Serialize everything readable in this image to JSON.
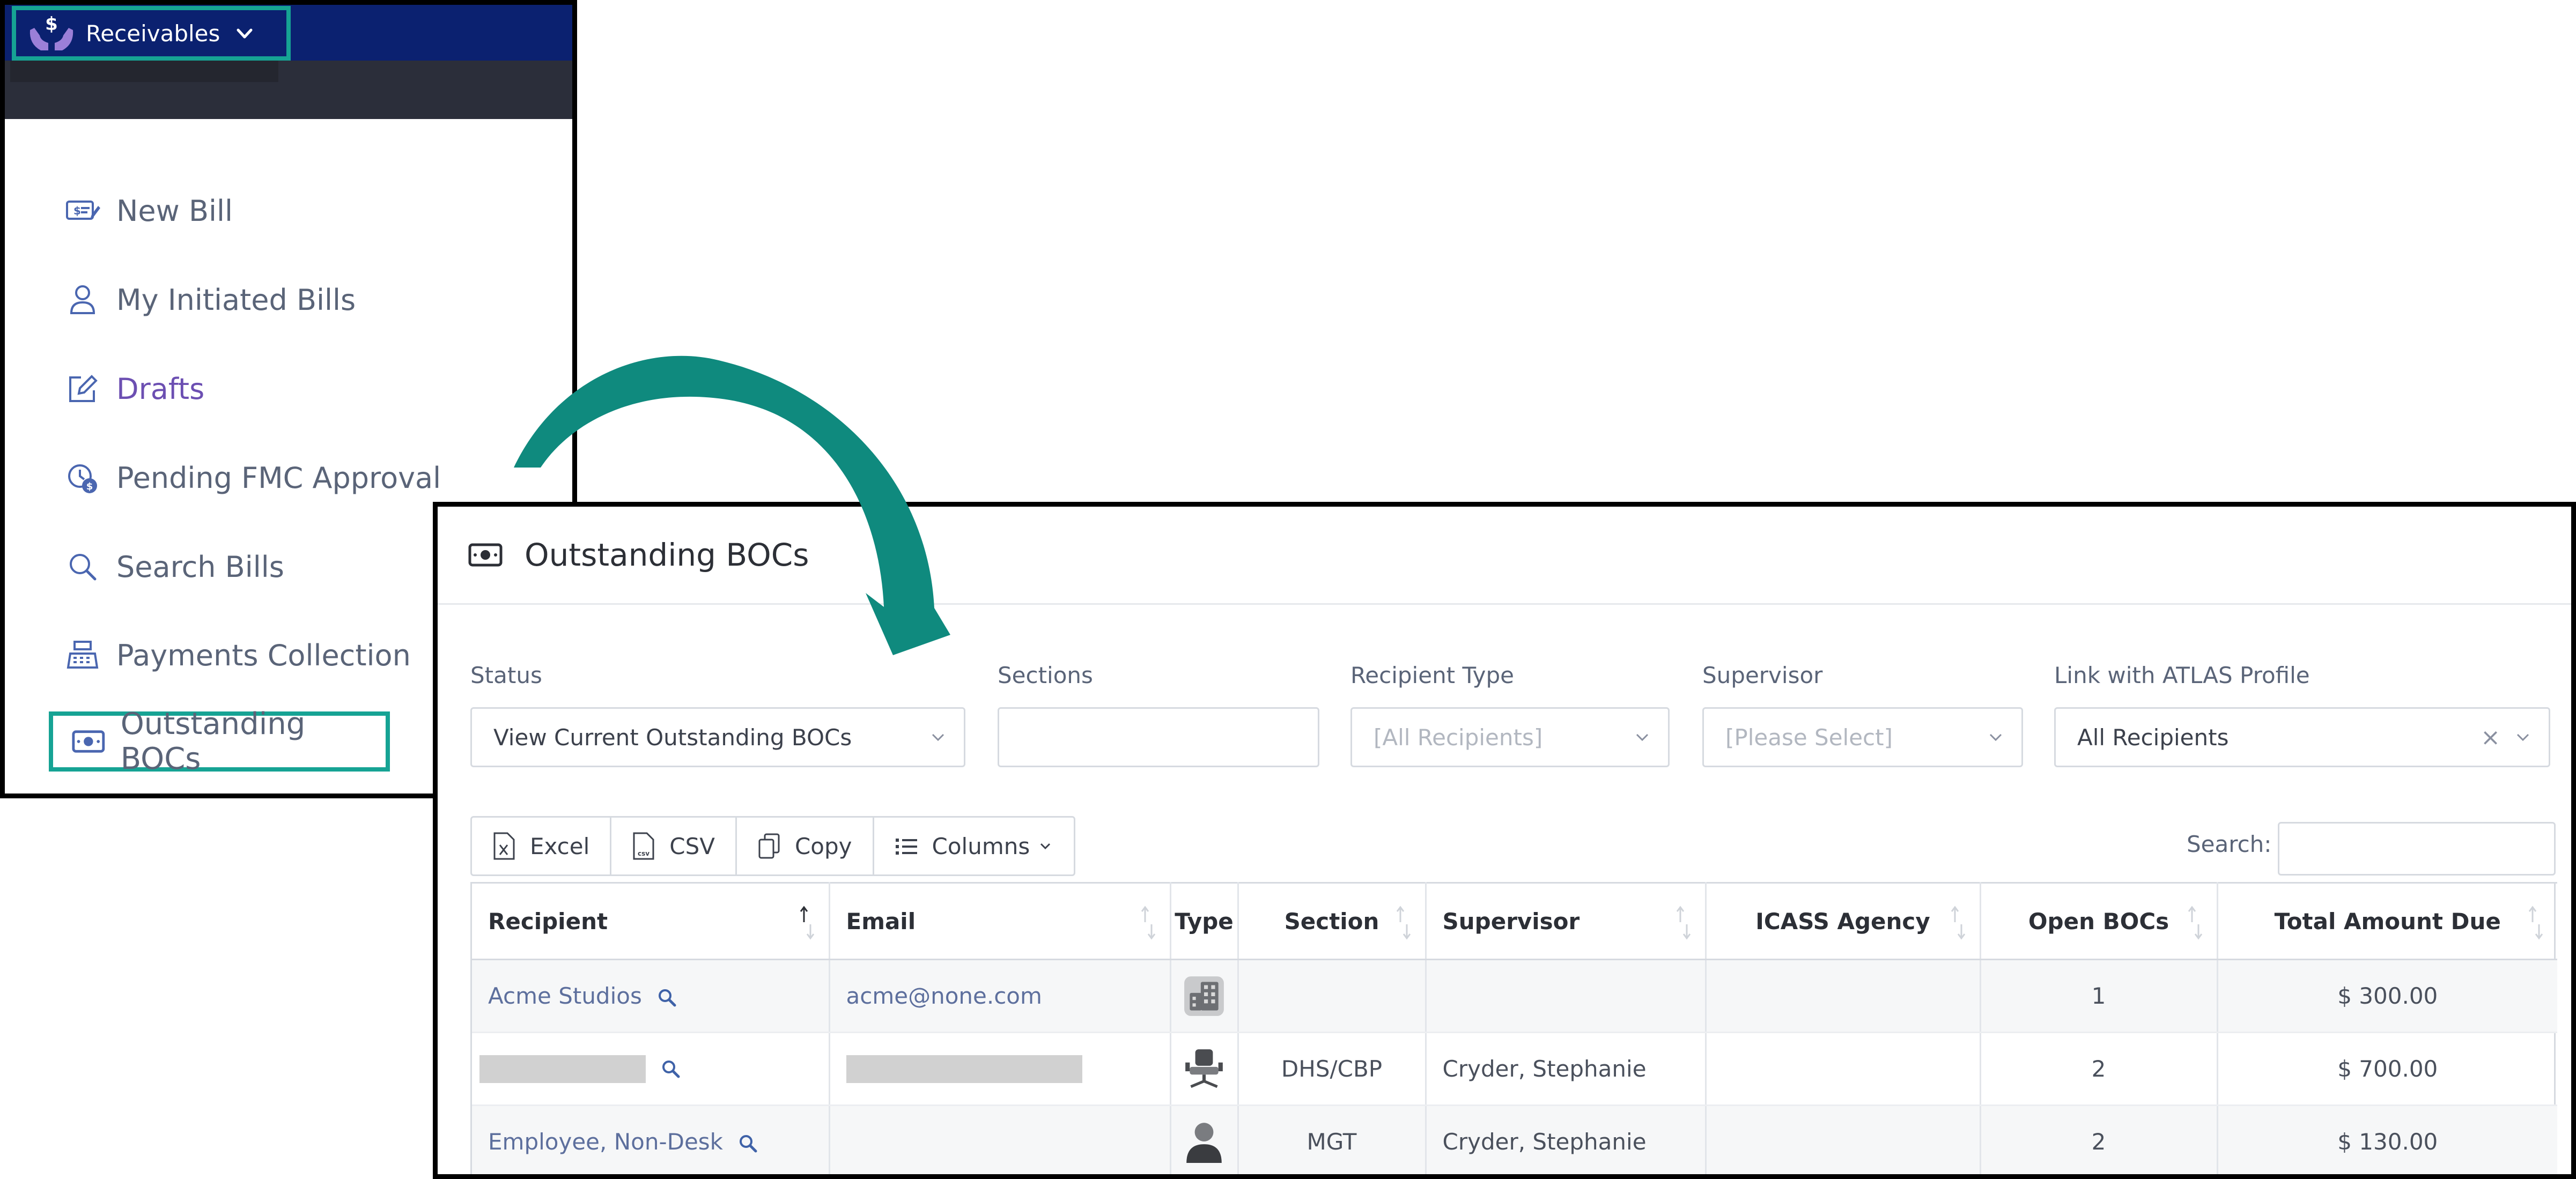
{
  "menu": {
    "dropdown_label": "Receivables",
    "items": [
      {
        "label": "New Bill",
        "icon": "bill-edit-icon"
      },
      {
        "label": "My Initiated Bills",
        "icon": "user-icon"
      },
      {
        "label": "Drafts",
        "icon": "edit-icon"
      },
      {
        "label": "Pending FMC Approval",
        "icon": "pending-money-icon"
      },
      {
        "label": "Search Bills",
        "icon": "search-icon"
      },
      {
        "label": "Payments Collection",
        "icon": "cash-register-icon"
      }
    ],
    "highlighted_item": {
      "label": "Outstanding BOCs",
      "icon": "money-bill-icon"
    }
  },
  "panel": {
    "title": "Outstanding BOCs",
    "filters": {
      "status": {
        "label": "Status",
        "value": "View Current Outstanding BOCs"
      },
      "sections": {
        "label": "Sections",
        "value": ""
      },
      "recipient_type": {
        "label": "Recipient Type",
        "placeholder": "[All Recipients]"
      },
      "supervisor": {
        "label": "Supervisor",
        "placeholder": "[Please Select]"
      },
      "atlas": {
        "label": "Link with ATLAS Profile",
        "value": "All Recipients"
      }
    },
    "toolbar": {
      "excel": "Excel",
      "csv": "CSV",
      "copy": "Copy",
      "columns": "Columns"
    },
    "search_label": "Search:",
    "columns": [
      "Recipient",
      "Email",
      "Type",
      "Section",
      "Supervisor",
      "ICASS Agency",
      "Open BOCs",
      "Total Amount Due"
    ],
    "rows": [
      {
        "recipient": "Acme Studios",
        "email": "acme@none.com",
        "type_icon": "building-icon",
        "section": "",
        "supervisor": "",
        "icass": "",
        "open_bocs": "1",
        "total": "$ 300.00"
      },
      {
        "recipient": "",
        "email": "",
        "type_icon": "desk-chair-icon",
        "section": "DHS/CBP",
        "supervisor": "Cryder, Stephanie",
        "icass": "",
        "open_bocs": "2",
        "total": "$ 700.00"
      },
      {
        "recipient": "Employee, Non-Desk",
        "email": "",
        "type_icon": "person-icon",
        "section": "MGT",
        "supervisor": "Cryder, Stephanie",
        "icass": "",
        "open_bocs": "2",
        "total": "$ 130.00"
      }
    ]
  },
  "colors": {
    "highlight": "#16a394",
    "arrow": "#0f8a7e",
    "nav_blue": "#0b2170",
    "drafts_purple": "#6c4fb2"
  }
}
